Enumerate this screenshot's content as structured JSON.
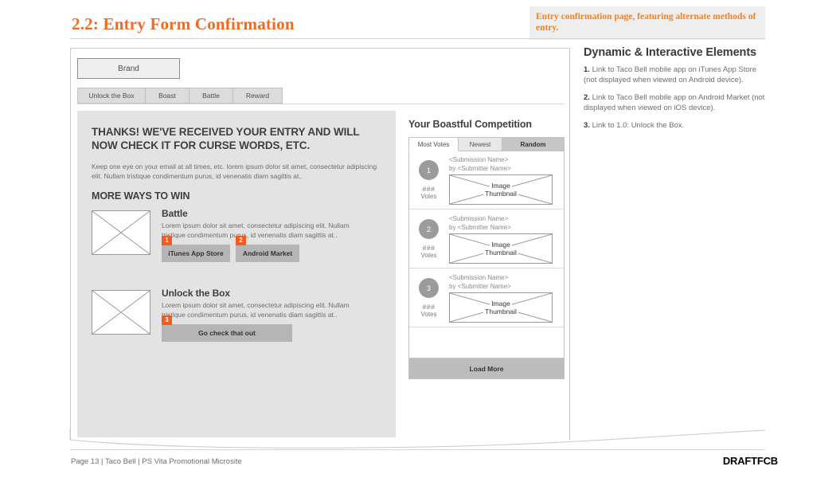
{
  "header": {
    "title": "2.2: Entry Form Confirmation",
    "note": "Entry confirmation page, featuring alternate methods of entry."
  },
  "annotations": {
    "title": "Dynamic & Interactive Elements",
    "items": [
      {
        "num": "1.",
        "text": " Link to Taco Bell mobile app on iTunes App Store (not displayed when viewed on Android device)."
      },
      {
        "num": "2.",
        "text": " Link to Taco Bell mobile app on Android Market (not displayed when viewed on iOS device)."
      },
      {
        "num": "3.",
        "text": " Link to 1.0: Unlock the Box."
      }
    ]
  },
  "wireframe": {
    "brand": "Brand",
    "nav": [
      {
        "label": "Unlock the Box"
      },
      {
        "label": "Boast"
      },
      {
        "label": "Battle"
      },
      {
        "label": "Reward"
      }
    ],
    "content": {
      "headline": "THANKS! WE'VE RECEIVED YOUR ENTRY AND WILL NOW CHECK IT FOR CURSE WORDS, ETC.",
      "intro": "Keep one eye on your email at all times, etc. lorem ipsum dolor sit amet, consectetur adipiscing elit. Nullam tristique condimentum purus, id venenatis diam sagittis at..",
      "subhead": "MORE WAYS TO WIN",
      "promos": [
        {
          "title": "Battle",
          "body": "Lorem ipsum dolor sit amet, consectetur adipiscing elit. Nullam tristique condimentum purus, id venenatis diam sagittis at..",
          "buttons": [
            {
              "label": "iTunes App Store",
              "badge": "1"
            },
            {
              "label": "Android Market",
              "badge": "2"
            }
          ]
        },
        {
          "title": "Unlock the Box",
          "body": "Lorem ipsum dolor sit amet, consectetur adipiscing elit. Nullam tristique condimentum purus, id venenatis diam sagittis at..",
          "buttons": [
            {
              "label": "Go check that out",
              "badge": "3"
            }
          ]
        }
      ]
    },
    "boast": {
      "title": "Your Boastful Competition",
      "tabs": [
        {
          "label": "Most Votes",
          "state": "active"
        },
        {
          "label": "Newest",
          "state": "plain"
        },
        {
          "label": "Random",
          "state": "dark"
        }
      ],
      "submissions": [
        {
          "rank": "1",
          "votes_num": "###",
          "votes_label": "Votes",
          "name": "<Submission Name>",
          "by": "by <Submitter Name>",
          "thumb_line1": "Image",
          "thumb_line2": "Thumbnail"
        },
        {
          "rank": "2",
          "votes_num": "###",
          "votes_label": "Votes",
          "name": "<Submission Name>",
          "by": "by <Submitter Name>",
          "thumb_line1": "Image",
          "thumb_line2": "Thumbnail"
        },
        {
          "rank": "3",
          "votes_num": "###",
          "votes_label": "Votes",
          "name": "<Submission Name>",
          "by": "by <Submitter Name>",
          "thumb_line1": "Image",
          "thumb_line2": "Thumbnail"
        }
      ],
      "load_more": "Load More"
    }
  },
  "footer": {
    "left": "Page 13 | Taco Bell | PS Vita Promotional Microsite",
    "logo": "DRAFTFCB"
  },
  "colors": {
    "accent_orange": "#f26a21",
    "badge_orange": "#f15a22",
    "panel_gray": "#e3e3e3",
    "button_gray": "#b5b5b5"
  }
}
